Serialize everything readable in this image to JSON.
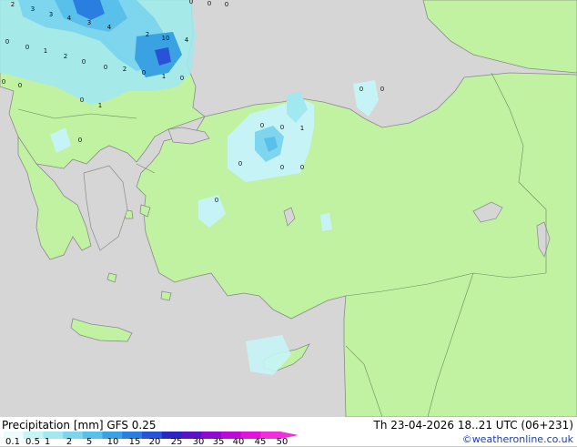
{
  "map": {
    "colors": {
      "sea": "#d6d6d6",
      "land": "#c0f2a2",
      "coast": "#8a8a8a",
      "border": "#6a8a5a"
    },
    "point_values": [
      {
        "text": "2"
      },
      {
        "text": "3"
      },
      {
        "text": "3"
      },
      {
        "text": "4"
      },
      {
        "text": "4"
      },
      {
        "text": "3"
      },
      {
        "text": "0"
      },
      {
        "text": "0"
      },
      {
        "text": "0"
      },
      {
        "text": "2"
      },
      {
        "text": "10"
      },
      {
        "text": "4"
      },
      {
        "text": "0"
      },
      {
        "text": "0"
      },
      {
        "text": "1"
      },
      {
        "text": "2"
      },
      {
        "text": "0"
      },
      {
        "text": "0"
      },
      {
        "text": "2"
      },
      {
        "text": "0"
      },
      {
        "text": "1"
      },
      {
        "text": "0"
      },
      {
        "text": "0"
      },
      {
        "text": "0"
      },
      {
        "text": "1"
      },
      {
        "text": "0"
      },
      {
        "text": "0"
      },
      {
        "text": "0"
      },
      {
        "text": "0"
      },
      {
        "text": "0"
      },
      {
        "text": "0"
      },
      {
        "text": "1"
      },
      {
        "text": "0"
      },
      {
        "text": "0"
      },
      {
        "text": "0"
      },
      {
        "text": "0"
      }
    ]
  },
  "footer": {
    "title": "Precipitation [mm]  GFS 0.25",
    "run": "Th 23-04-2026 18..21 UTC (06+231)",
    "credit": "©weatheronline.co.uk"
  },
  "legend": {
    "labels": [
      "0.1",
      "0.5",
      "1",
      "2",
      "5",
      "10",
      "15",
      "20",
      "25",
      "30",
      "35",
      "40",
      "45",
      "50"
    ],
    "colors": [
      "#eafcfc",
      "#c6f4f6",
      "#a2e8f0",
      "#7ed6ee",
      "#58c0ea",
      "#3aa2e2",
      "#2a7ee0",
      "#2a52d8",
      "#2a26c4",
      "#5a12c8",
      "#8e0ad0",
      "#be0ad6",
      "#e014d8",
      "#f030d8"
    ]
  }
}
